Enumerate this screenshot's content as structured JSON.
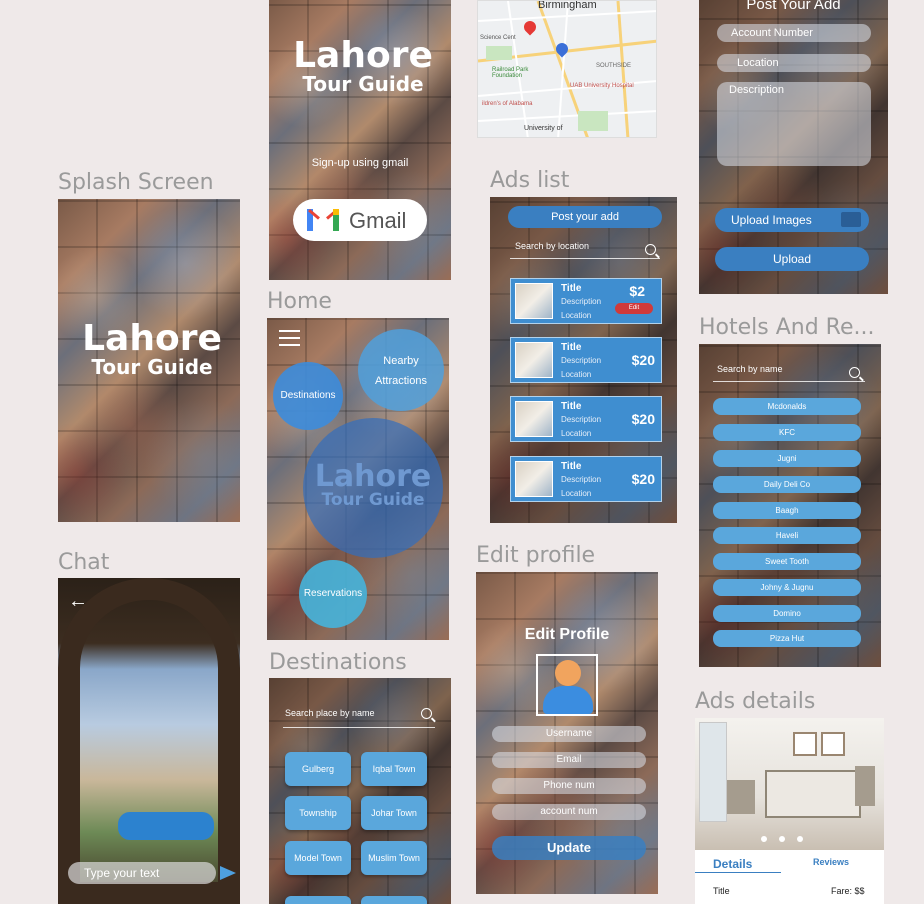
{
  "labels": {
    "splash": "Splash Screen",
    "chat": "Chat",
    "home": "Home",
    "destinations": "Destinations",
    "ads_list": "Ads list",
    "edit_profile": "Edit profile",
    "hotels": "Hotels And Re...",
    "ads_details": "Ads details"
  },
  "logo": {
    "line1": "Lahore",
    "line2": "Tour Guide"
  },
  "signup": {
    "text": "Sign-up using gmail",
    "gmail": "Gmail"
  },
  "map": {
    "city": "Birmingham",
    "labels": [
      "Science Cent",
      "Railroad Park Foundation",
      "SOUTHSIDE",
      "UAB University Hospital",
      "ildren's of Alabama",
      "University of"
    ]
  },
  "post_ad": {
    "title": "Post Your Add",
    "account": "Account Number",
    "location": "Location",
    "description": "Description",
    "upload_images": "Upload Images",
    "upload": "Upload"
  },
  "home": {
    "nearby": "Nearby Attractions",
    "destinations": "Destinations",
    "reservations": "Reservations"
  },
  "chat": {
    "placeholder": "Type your text"
  },
  "destinations": {
    "search": "Search place by name",
    "places": [
      "Gulberg",
      "Iqbal Town",
      "Township",
      "Johar Town",
      "Model Town",
      "Muslim Town"
    ]
  },
  "ads_list": {
    "post_button": "Post your add",
    "search": "Search by location",
    "edit": "Edit",
    "ads": [
      {
        "title": "Title",
        "desc": "Description",
        "loc": "Location",
        "price": "$2"
      },
      {
        "title": "Title",
        "desc": "Description",
        "loc": "Location",
        "price": "$20"
      },
      {
        "title": "Title",
        "desc": "Description",
        "loc": "Location",
        "price": "$20"
      },
      {
        "title": "Title",
        "desc": "Description",
        "loc": "Location",
        "price": "$20"
      }
    ]
  },
  "edit_profile": {
    "title": "Edit Profile",
    "username": "Username",
    "email": "Email",
    "phone": "Phone num",
    "account": "account num",
    "update": "Update"
  },
  "hotels": {
    "search": "Search by name",
    "items": [
      "Mcdonalds",
      "KFC",
      "Jugni",
      "Daily Deli Co",
      "Baagh",
      "Haveli",
      "Sweet Tooth",
      "Johny & Jugnu",
      "Domino",
      "Pizza Hut"
    ]
  },
  "ads_details": {
    "details_tab": "Details",
    "reviews_tab": "Reviews",
    "title": "Title",
    "fare": "Fare: $$"
  },
  "colors": {
    "accent": "#3a7fc1",
    "light_blue": "#5aa7dc",
    "bg": "#efe9e9"
  }
}
